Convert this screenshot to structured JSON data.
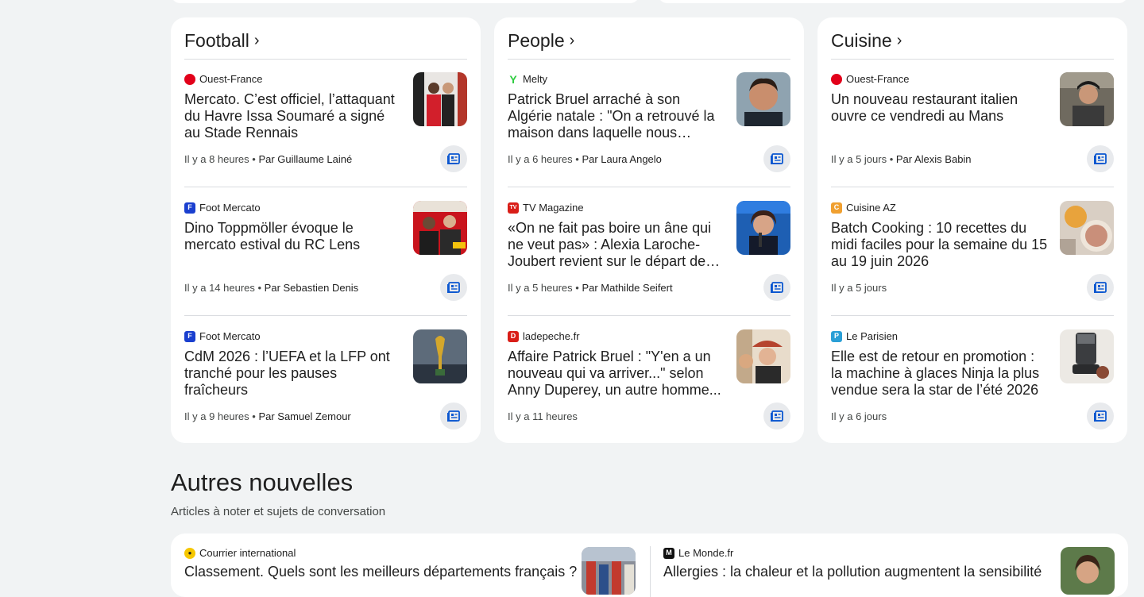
{
  "columns": [
    {
      "title": "Football",
      "articles": [
        {
          "source": "Ouest-France",
          "logo_char": "",
          "logo_color": "#e2001a",
          "headline": "Mercato. C’est officiel, l’attaquant du Havre Issa Soumaré a signé au Stade Rennais",
          "time": "Il y a 8 heures",
          "author": "Par Guillaume Lainé"
        },
        {
          "source": "Foot Mercato",
          "logo_char": "F",
          "logo_color": "#1a3fcf",
          "headline": "Dino Toppmöller évoque le mercato estival du RC Lens",
          "time": "Il y a 14 heures",
          "author": "Par Sebastien Denis"
        },
        {
          "source": "Foot Mercato",
          "logo_char": "F",
          "logo_color": "#1a3fcf",
          "headline": "CdM 2026 : l’UEFA et la LFP ont tranché pour les pauses fraîcheurs",
          "time": "Il y a 9 heures",
          "author": "Par Samuel Zemour"
        }
      ]
    },
    {
      "title": "People",
      "articles": [
        {
          "source": "Melty",
          "logo_char": "Y",
          "logo_color": "#2ecc40",
          "headline": "Patrick Bruel arraché à son Algérie natale : \"On a retrouvé la maison dans laquelle nous habitions\", ce...",
          "time": "Il y a 6 heures",
          "author": "Par Laura Angelo"
        },
        {
          "source": "TV Magazine",
          "logo_char": "TV",
          "logo_color": "#d91e18",
          "headline": "«On ne fait pas boire un âne qui ne veut pas» : Alexia Laroche-Joubert revient sur le départ de Cyril...",
          "time": "Il y a 5 heures",
          "author": "Par Mathilde Seifert"
        },
        {
          "source": "ladepeche.fr",
          "logo_char": "D",
          "logo_color": "#d91e18",
          "headline": "Affaire Patrick Bruel : \"Y'en a un nouveau qui va arriver...\" selon Anny Duperey, un autre homme...",
          "time": "Il y a 11 heures",
          "author": ""
        }
      ]
    },
    {
      "title": "Cuisine",
      "articles": [
        {
          "source": "Ouest-France",
          "logo_char": "",
          "logo_color": "#e2001a",
          "headline": "Un nouveau restaurant italien ouvre ce vendredi au Mans",
          "time": "Il y a 5 jours",
          "author": "Par Alexis Babin"
        },
        {
          "source": "Cuisine AZ",
          "logo_char": "C",
          "logo_color": "#f0a030",
          "headline": "Batch Cooking : 10 recettes du midi faciles pour la semaine du 15 au 19 juin 2026",
          "time": "Il y a 5 jours",
          "author": ""
        },
        {
          "source": "Le Parisien",
          "logo_char": "P",
          "logo_color": "#2a9fd6",
          "headline": "Elle est de retour en promotion : la machine à glaces Ninja la plus vendue sera la star de l’été 2026",
          "time": "Il y a 6 jours",
          "author": ""
        }
      ]
    }
  ],
  "other_news": {
    "title": "Autres nouvelles",
    "subtitle": "Articles à noter et sujets de conversation",
    "items": [
      {
        "source": "Courrier international",
        "logo_char": "●",
        "logo_color": "#222222",
        "headline": "Classement. Quels sont les meilleurs départements français ?"
      },
      {
        "source": "Le Monde.fr",
        "logo_char": "M",
        "logo_color": "#111111",
        "headline": "Allergies : la chaleur et la pollution augmentent la sensibilité"
      }
    ]
  },
  "colors": {
    "accent": "#0b57d0",
    "background": "#f1f3f4",
    "card": "#ffffff"
  }
}
